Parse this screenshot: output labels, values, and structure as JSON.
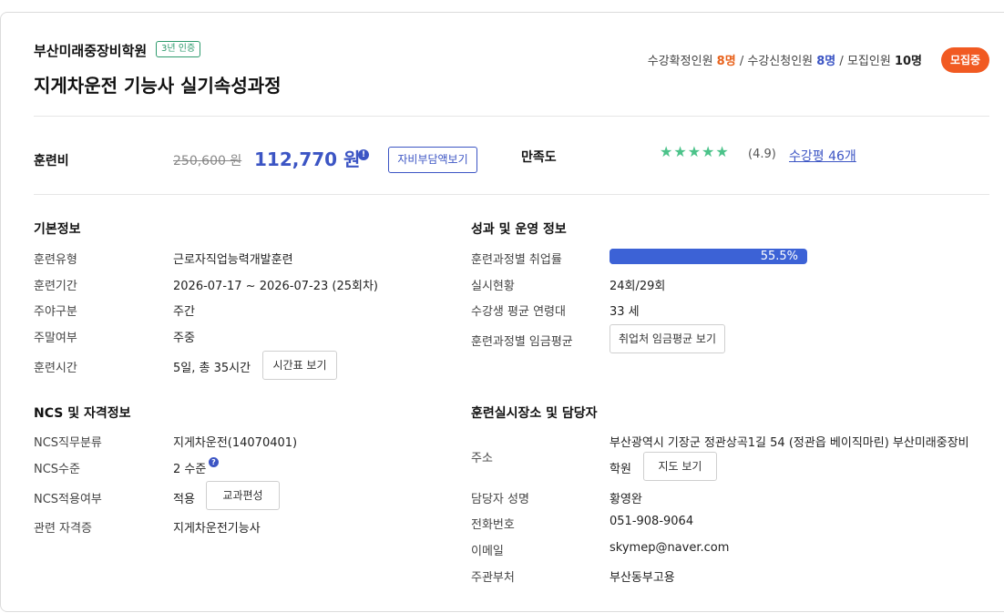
{
  "header": {
    "institution": "부산미래중장비학원",
    "cert_badge": "3년 인증",
    "course_title": "지게차운전 기능사 실기속성과정",
    "enroll": {
      "confirmed_label": "수강확정인원",
      "confirmed_value": "8명",
      "applied_label": "수강신청인원",
      "applied_value": "8명",
      "recruit_label": "모집인원",
      "recruit_value": "10명",
      "sep": "/"
    },
    "status": "모집중"
  },
  "fee": {
    "label": "훈련비",
    "original": "250,600 원",
    "price": "112,770 원",
    "info_icon": "!",
    "self_pay_button": "자비부담액보기"
  },
  "satisfaction": {
    "label": "만족도",
    "stars": "★★★★★",
    "rating": "(4.9)",
    "review_link": "수강평 46개",
    "star_color": "#4cc38a"
  },
  "basic_info": {
    "title": "기본정보",
    "rows": [
      {
        "label": "훈련유형",
        "value": "근로자직업능력개발훈련"
      },
      {
        "label": "훈련기간",
        "value": "2026-07-17 ~ 2026-07-23 (25회차)"
      },
      {
        "label": "주야구분",
        "value": "주간"
      },
      {
        "label": "주말여부",
        "value": "주중"
      },
      {
        "label": "훈련시간",
        "value": "5일, 총 35시간"
      }
    ],
    "timetable_button": "시간표 보기"
  },
  "performance": {
    "title": "성과 및 운영 정보",
    "employment_label": "훈련과정별 취업률",
    "employment_rate": 55.5,
    "employment_text": "55.5%",
    "sessions_label": "실시현황",
    "sessions_value": "24회/29회",
    "age_label": "수강생 평균 연령대",
    "age_value": "33 세",
    "wage_label": "훈련과정별 임금평균",
    "wage_button": "취업처 임금평균 보기"
  },
  "ncs": {
    "title": "NCS 및 자격정보",
    "job_label": "NCS직무분류",
    "job_value": "지게차운전(14070401)",
    "level_label": "NCS수준",
    "level_value": "2 수준",
    "help_icon": "?",
    "apply_label": "NCS적용여부",
    "apply_value": "적용",
    "curriculum_button": "교과편성",
    "cert_label": "관련 자격증",
    "cert_value": "지게차운전기능사"
  },
  "location": {
    "title": "훈련실시장소 및 담당자",
    "address_label": "주소",
    "address_line1": "부산광역시 기장군 정관상곡1길 54 (정관읍 베이직마린) 부산미래중장비",
    "address_line2": "학원",
    "map_button": "지도 보기",
    "manager_label": "담당자 성명",
    "manager_value": "황영완",
    "phone_label": "전화번호",
    "phone_value": "051-908-9064",
    "email_label": "이메일",
    "email_value": "skymep@naver.com",
    "office_label": "주관부처",
    "office_value": "부산동부고용"
  }
}
